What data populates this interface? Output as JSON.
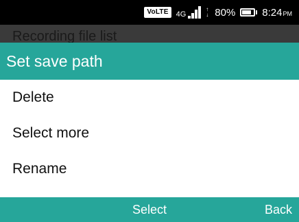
{
  "status_bar": {
    "volte_label": "VoLTE",
    "network_label": "4G",
    "battery_percent_text": "80%",
    "battery_level": 0.8,
    "time": "8:24",
    "time_suffix": "PM",
    "icons": [
      "volte-icon",
      "signal-icon",
      "roaming-arrows-icon",
      "battery-icon"
    ]
  },
  "background": {
    "partial_title": "Recording file list"
  },
  "menu": {
    "title": "Set save path",
    "items": [
      {
        "label": "Delete"
      },
      {
        "label": "Select more"
      },
      {
        "label": "Rename"
      }
    ]
  },
  "softkeys": {
    "left": "",
    "center": "Select",
    "right": "Back"
  },
  "colors": {
    "accent": "#26a69a",
    "status_bar": "#000000",
    "menu_background": "#ffffff",
    "text": "#111111"
  }
}
